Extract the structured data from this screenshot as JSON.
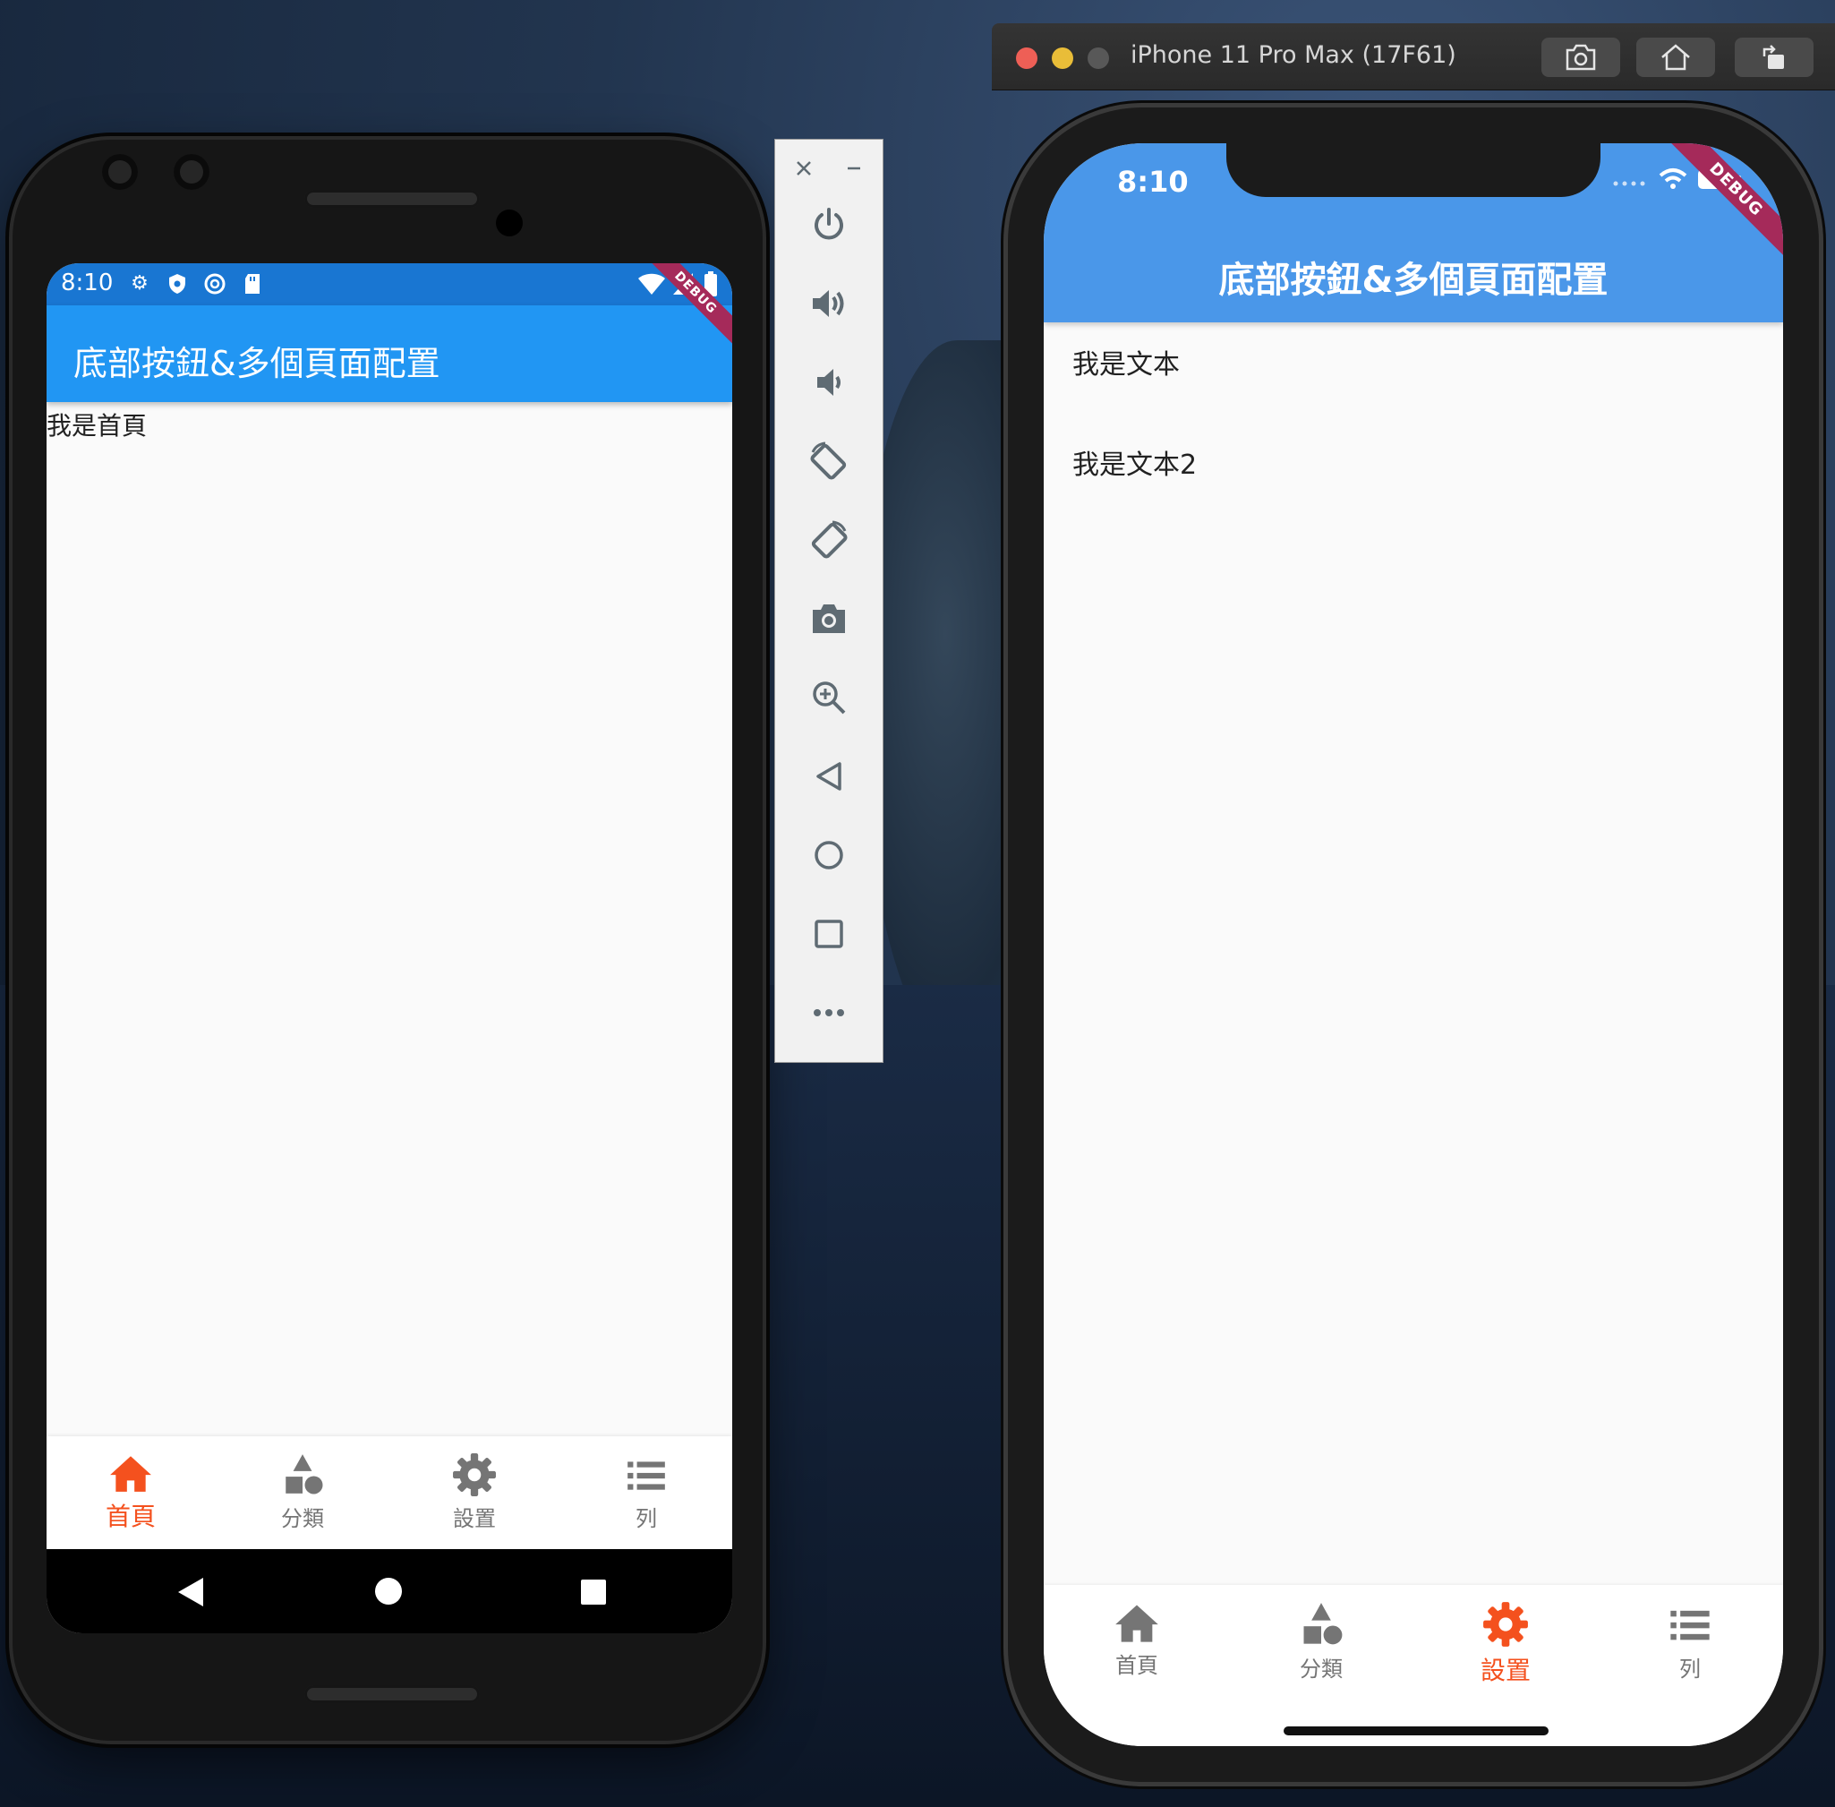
{
  "android": {
    "status_time": "8:10",
    "app_title": "底部按鈕&多個頁面配置",
    "debug_banner": "DEBUG",
    "body_text": "我是首頁",
    "nav": [
      {
        "label": "首頁",
        "icon": "home-icon",
        "active": true
      },
      {
        "label": "分類",
        "icon": "category-icon",
        "active": false
      },
      {
        "label": "設置",
        "icon": "gear-icon",
        "active": false
      },
      {
        "label": "列",
        "icon": "list-icon",
        "active": false
      }
    ]
  },
  "emulator_toolbar": {
    "buttons": [
      "close-icon",
      "minimize-icon",
      "power-icon",
      "volume-up-icon",
      "volume-down-icon",
      "rotate-left-icon",
      "rotate-right-icon",
      "camera-icon",
      "zoom-icon",
      "back-icon",
      "home-icon",
      "overview-icon",
      "more-icon"
    ]
  },
  "simulator": {
    "window_title": "iPhone 11 Pro Max (17F61)",
    "status_time": "8:10",
    "app_title": "底部按鈕&多個頁面配置",
    "debug_banner": "DEBUG",
    "texts": [
      "我是文本",
      "我是文本2"
    ],
    "nav": [
      {
        "label": "首頁",
        "icon": "home-icon",
        "active": false
      },
      {
        "label": "分類",
        "icon": "category-icon",
        "active": false
      },
      {
        "label": "設置",
        "icon": "gear-icon",
        "active": true
      },
      {
        "label": "列",
        "icon": "list-icon",
        "active": false
      }
    ]
  },
  "colors": {
    "accent": "#f4511e",
    "inactive": "#757575",
    "appbar_android": "#2196f3",
    "appbar_ios": "#4a97e9",
    "debug": "#a52a5a"
  }
}
